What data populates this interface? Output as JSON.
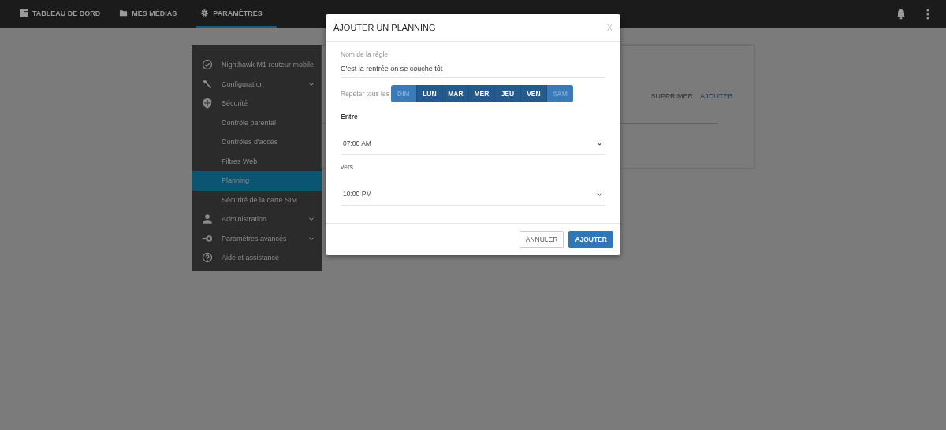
{
  "top_nav": {
    "tabs": [
      {
        "label": "TABLEAU DE BORD",
        "selected": false
      },
      {
        "label": "MES MÉDIAS",
        "selected": false
      },
      {
        "label": "PARAMÈTRES",
        "selected": true
      }
    ]
  },
  "sidebar": {
    "items": [
      {
        "label": "Nighthawk M1 routeur mobile"
      },
      {
        "label": "Configuration",
        "expanded": false
      },
      {
        "label": "Sécurité",
        "expanded": true,
        "children": [
          {
            "label": "Contrôle parental",
            "selected": false
          },
          {
            "label": "Contrôles d'accès",
            "selected": false
          },
          {
            "label": "Filtres Web",
            "selected": false
          },
          {
            "label": "Planning",
            "selected": true
          },
          {
            "label": "Sécurité de la carte SIM",
            "selected": false
          }
        ]
      },
      {
        "label": "Administration",
        "expanded": false
      },
      {
        "label": "Paramètres avancés",
        "expanded": false
      },
      {
        "label": "Aide et assistance"
      }
    ]
  },
  "content": {
    "actions": [
      "SUPPRIMER",
      "AJOUTER"
    ]
  },
  "dialog": {
    "title": "AJOUTER UN PLANNING",
    "close": "X",
    "rule_name": {
      "label": "Nom de la règle",
      "value": "C'est la rentrée on se couche tôt"
    },
    "repeat": {
      "label": "Répéter tous les",
      "days": [
        {
          "label": "DIM",
          "selected": false
        },
        {
          "label": "LUN",
          "selected": true
        },
        {
          "label": "MAR",
          "selected": true
        },
        {
          "label": "MER",
          "selected": true
        },
        {
          "label": "JEU",
          "selected": true
        },
        {
          "label": "VEN",
          "selected": true
        },
        {
          "label": "SAM",
          "selected": false
        }
      ]
    },
    "between_label": "Entre",
    "start": "07:00 AM",
    "to_label": "vers",
    "end": "10:00 PM",
    "buttons": [
      {
        "label": "ANNULER",
        "kind": "secondary"
      },
      {
        "label": "AJOUTER",
        "kind": "primary"
      }
    ]
  }
}
